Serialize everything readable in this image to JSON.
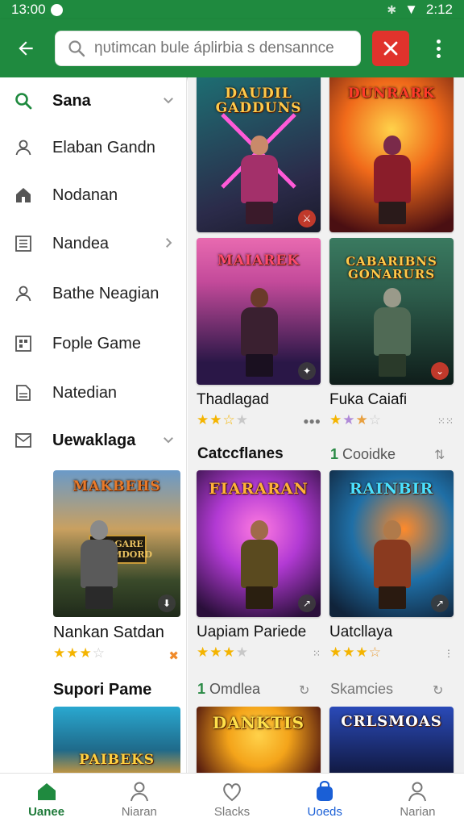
{
  "status_bar": {
    "time": "13:00",
    "right_time": "2:12"
  },
  "app_bar": {
    "search_placeholder": "ηυtimcan bule áplirbia s densannce"
  },
  "sidebar": {
    "items": [
      {
        "label": "Sana",
        "icon": "search-icon",
        "chevron": "down"
      },
      {
        "label": "Elaban Gandn",
        "icon": "person-icon"
      },
      {
        "label": "Nodanan",
        "icon": "home-icon"
      },
      {
        "label": "Nandea",
        "icon": "list-icon",
        "chevron": "right"
      },
      {
        "label": "Bathe Neagian",
        "icon": "person-icon"
      },
      {
        "label": "Fople Game",
        "icon": "grid-icon"
      },
      {
        "label": "Natedian",
        "icon": "document-icon"
      },
      {
        "label": "Uewaklaga",
        "icon": "mail-icon",
        "chevron": "down"
      }
    ],
    "featured": {
      "thumb_title": "MAKBEHS",
      "thumb_subtitle": "BURGARE DERMDORD",
      "title": "Nankan Satdan",
      "rating": 3.5
    },
    "section2_title": "Supori Pame",
    "section2_thumb_title": "PAIBEKS"
  },
  "grid": {
    "cards": [
      {
        "thumb_title": "DAUDIL GADDUNS",
        "title": "",
        "colors": [
          "#1d6f73",
          "#2b2b4a"
        ],
        "figure": "#a3306a"
      },
      {
        "thumb_title": "DUNRARK",
        "title": "",
        "colors": [
          "#f06a1a",
          "#4a0f12"
        ],
        "figure": "#8a1d2a"
      },
      {
        "thumb_title": "MAIAREK",
        "title": "Thadlagad",
        "rating": 2.5,
        "colors": [
          "#c34a9a",
          "#2a1747"
        ],
        "figure": "#3a2030"
      },
      {
        "thumb_title": "CABARIBNS GONARURS",
        "title": "Fuka Caiafi",
        "rating": 2.5,
        "colors": [
          "#2c5b4a",
          "#0f1d1a"
        ],
        "figure": "#506a55"
      },
      {
        "thumb_title": "FIARARAN",
        "title": "Uapiam Pariede",
        "rating": 3,
        "colors": [
          "#b23ad4",
          "#2a0f3a"
        ],
        "figure": "#5a4a1f"
      },
      {
        "thumb_title": "RAINBIR",
        "title": "Uatcllaya",
        "rating": 3.5,
        "colors": [
          "#1f6fa6",
          "#10233a"
        ],
        "figure": "#8a3a1f"
      },
      {
        "thumb_title": "DANKTIS",
        "title": "",
        "colors": [
          "#f4a41a",
          "#5a1f0f"
        ],
        "figure": "#a3302a"
      },
      {
        "thumb_title": "CRLSMOAS",
        "title": "",
        "colors": [
          "#2a4ab8",
          "#0f1538"
        ],
        "figure": "#6a4a3a"
      }
    ],
    "section1": {
      "title": "Catccflanes",
      "count_num": "1",
      "count_label": "Cooidke"
    },
    "section2": {
      "left_num": "1",
      "left_label": "Omdlea",
      "right_label": "Skamcies"
    }
  },
  "bottom_nav": [
    {
      "label": "Uanee",
      "icon": "home-icon",
      "state": "active-green"
    },
    {
      "label": "Niaran",
      "icon": "person-icon",
      "state": ""
    },
    {
      "label": "Slacks",
      "icon": "heart-icon",
      "state": ""
    },
    {
      "label": "Uoeds",
      "icon": "bag-icon",
      "state": "active-blue"
    },
    {
      "label": "Narian",
      "icon": "person-icon",
      "state": ""
    }
  ],
  "colors": {
    "brand_green": "#1f8a3f",
    "close_red": "#e0332c",
    "star": "#f4b400",
    "active_blue": "#1a5fd6"
  }
}
